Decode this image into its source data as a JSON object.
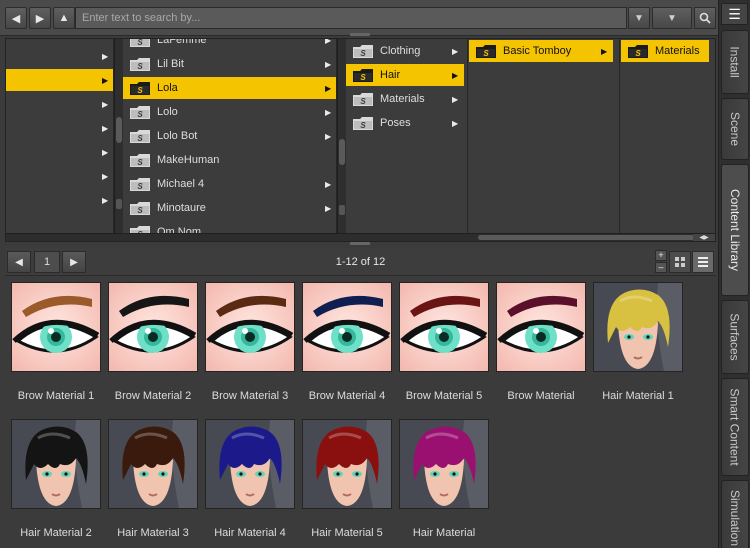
{
  "search": {
    "placeholder": "Enter text to search by..."
  },
  "browser": {
    "col1": {
      "arrow": "▶"
    },
    "col2": {
      "items": [
        {
          "label": "LaFemme",
          "has_children": true
        },
        {
          "label": "Lil Bit",
          "has_children": true
        },
        {
          "label": "Lola",
          "has_children": true,
          "selected": true
        },
        {
          "label": "Lolo",
          "has_children": true
        },
        {
          "label": "Lolo Bot",
          "has_children": true
        },
        {
          "label": "MakeHuman",
          "has_children": false
        },
        {
          "label": "Michael 4",
          "has_children": true
        },
        {
          "label": "Minotaure",
          "has_children": true
        },
        {
          "label": "Om Nom",
          "has_children": false
        }
      ]
    },
    "col3": {
      "items": [
        {
          "label": "Clothing",
          "has_children": true
        },
        {
          "label": "Hair",
          "has_children": true,
          "selected": true
        },
        {
          "label": "Materials",
          "has_children": true
        },
        {
          "label": "Poses",
          "has_children": true
        }
      ]
    },
    "col4": {
      "items": [
        {
          "label": "Basic Tomboy",
          "has_children": true,
          "selected": true
        }
      ]
    },
    "col5": {
      "items": [
        {
          "label": "Materials",
          "has_children": false,
          "selected": true
        }
      ]
    }
  },
  "pager": {
    "page": "1",
    "count": "1-12 of 12"
  },
  "thumbnails": [
    {
      "label": "Brow Material 1",
      "kind": "brow",
      "color": "#9a5a2a"
    },
    {
      "label": "Brow Material 2",
      "kind": "brow",
      "color": "#161616"
    },
    {
      "label": "Brow Material 3",
      "kind": "brow",
      "color": "#5a2a12"
    },
    {
      "label": "Brow Material 4",
      "kind": "brow",
      "color": "#0f1f52"
    },
    {
      "label": "Brow Material 5",
      "kind": "brow",
      "color": "#6a1414"
    },
    {
      "label": "Brow Material",
      "kind": "brow",
      "color": "#5a0f2a"
    },
    {
      "label": "Hair Material 1",
      "kind": "hair",
      "color": "#d8c040"
    },
    {
      "label": "Hair Material 2",
      "kind": "hair",
      "color": "#141414"
    },
    {
      "label": "Hair Material 3",
      "kind": "hair",
      "color": "#3a1a0c"
    },
    {
      "label": "Hair Material 4",
      "kind": "hair",
      "color": "#1c1a8a"
    },
    {
      "label": "Hair Material 5",
      "kind": "hair",
      "color": "#8a1010"
    },
    {
      "label": "Hair Material",
      "kind": "hair",
      "color": "#9a1070"
    }
  ],
  "tabs": [
    {
      "label": "Install"
    },
    {
      "label": "Scene"
    },
    {
      "label": "Content Library",
      "active": true
    },
    {
      "label": "Surfaces"
    },
    {
      "label": "Smart Content"
    },
    {
      "label": "Simulation"
    }
  ],
  "colors": {
    "selection": "#f5c400",
    "panel": "#3b3b3b",
    "folder": "#d9d9d9"
  }
}
